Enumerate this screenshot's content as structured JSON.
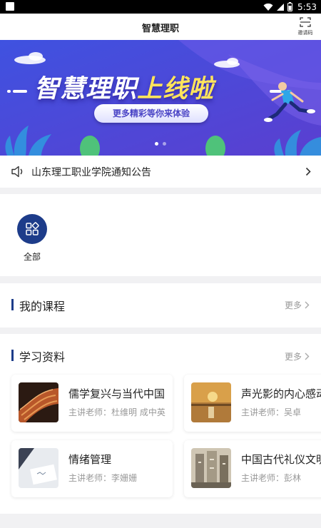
{
  "status_bar": {
    "time": "5:53"
  },
  "header": {
    "title": "智慧理职",
    "scan_label": "邀请码"
  },
  "banner": {
    "title_part1": "智慧理职",
    "title_part2": "上线啦",
    "subtitle": "更多精彩等你来体验",
    "slides_total": 2,
    "active_slide": 1
  },
  "notice": {
    "text": "山东理工职业学院通知公告"
  },
  "categories": [
    {
      "label": "全部",
      "icon": "grid-icon"
    }
  ],
  "my_courses": {
    "title": "我的课程",
    "more_label": "更多"
  },
  "materials": {
    "title": "学习资料",
    "more_label": "更多",
    "items": [
      {
        "title": "儒学复兴与当代中国",
        "teacher": "主讲老师：杜维明 成中英"
      },
      {
        "title": "声光影的内心感动",
        "teacher": "主讲老师：吴卓"
      },
      {
        "title": "情绪管理",
        "teacher": "主讲老师：李姗姗"
      },
      {
        "title": "中国古代礼仪文明",
        "teacher": "主讲老师：彭林"
      }
    ]
  },
  "colors": {
    "accent": "#1d3c8a",
    "banner_bg": "#4e47d3"
  }
}
